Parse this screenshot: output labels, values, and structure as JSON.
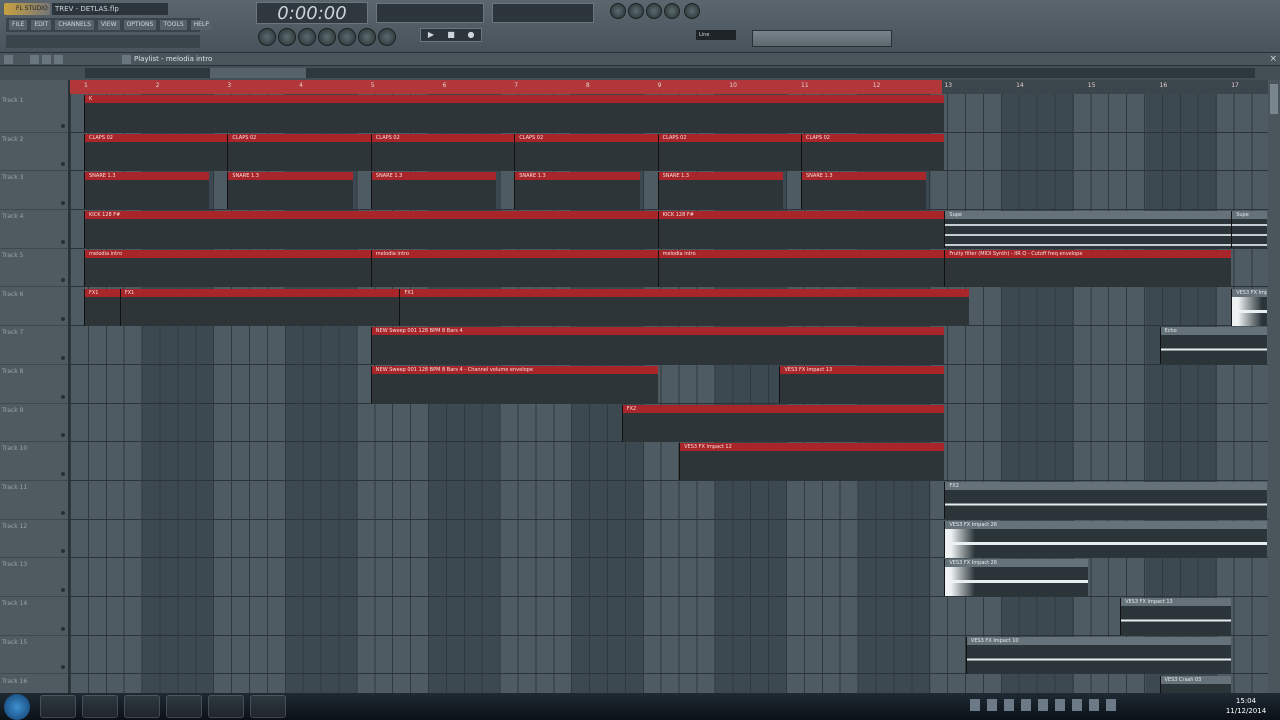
{
  "app": {
    "logo": "FL STUDIO",
    "project_title": "TREV - DETLAS.flp",
    "time_display": "0:00:00",
    "menu": [
      "FILE",
      "EDIT",
      "CHANNELS",
      "VIEW",
      "OPTIONS",
      "TOOLS",
      "HELP"
    ],
    "transport": [
      "▶",
      "■",
      "●"
    ],
    "snap_mode": "Line",
    "browser_search": ""
  },
  "playlist": {
    "title": "Playlist - melodia intro",
    "close": "×"
  },
  "ruler": [
    "1",
    "2",
    "3",
    "4",
    "5",
    "6",
    "7",
    "8",
    "9",
    "10",
    "11",
    "12",
    "13",
    "14",
    "15",
    "16",
    "17"
  ],
  "tracks": [
    "Track 1",
    "Track 2",
    "Track 3",
    "Track 4",
    "Track 5",
    "Track 6",
    "Track 7",
    "Track 8",
    "Track 9",
    "Track 10",
    "Track 11",
    "Track 12",
    "Track 13",
    "Track 14",
    "Track 15",
    "Track 16"
  ],
  "colors": {
    "clip_red": "#a8262a",
    "clip_grey": "#66727a",
    "waveform_pink": "#f2a3a6"
  },
  "clips": [
    {
      "track": 1,
      "start": 1,
      "len": 12,
      "label": "K",
      "color": "red",
      "kind": "hits"
    },
    {
      "track": 2,
      "start": 1,
      "len": 2,
      "label": "CLAPS 02",
      "color": "red",
      "kind": "hits"
    },
    {
      "track": 2,
      "start": 3,
      "len": 2,
      "label": "CLAPS 02",
      "color": "red",
      "kind": "hits"
    },
    {
      "track": 2,
      "start": 5,
      "len": 2,
      "label": "CLAPS 02",
      "color": "red",
      "kind": "hits"
    },
    {
      "track": 2,
      "start": 7,
      "len": 2,
      "label": "CLAPS 02",
      "color": "red",
      "kind": "hits"
    },
    {
      "track": 2,
      "start": 9,
      "len": 2,
      "label": "CLAPS 02",
      "color": "red",
      "kind": "hits"
    },
    {
      "track": 2,
      "start": 11,
      "len": 2,
      "label": "CLAPS 02",
      "color": "red",
      "kind": "hits"
    },
    {
      "track": 3,
      "start": 1,
      "len": 1.75,
      "label": "SNARE 1.3",
      "color": "red",
      "kind": "hits"
    },
    {
      "track": 3,
      "start": 3,
      "len": 1.75,
      "label": "SNARE 1.3",
      "color": "red",
      "kind": "hits"
    },
    {
      "track": 3,
      "start": 5,
      "len": 1.75,
      "label": "SNARE 1.3",
      "color": "red",
      "kind": "hits"
    },
    {
      "track": 3,
      "start": 7,
      "len": 1.75,
      "label": "SNARE 1.3",
      "color": "red",
      "kind": "hits"
    },
    {
      "track": 3,
      "start": 9,
      "len": 1.75,
      "label": "SNARE 1.3",
      "color": "red",
      "kind": "hits"
    },
    {
      "track": 3,
      "start": 11,
      "len": 1.75,
      "label": "SNARE 1.3",
      "color": "red",
      "kind": "hits"
    },
    {
      "track": 4,
      "start": 1,
      "len": 8,
      "label": "KICK 128 F#",
      "color": "red",
      "kind": "hits"
    },
    {
      "track": 4,
      "start": 9,
      "len": 4,
      "label": "KICK 128 F#",
      "color": "red",
      "kind": "hits"
    },
    {
      "track": 4,
      "start": 13,
      "len": 4,
      "label": "Supe",
      "color": "grey",
      "kind": "lines"
    },
    {
      "track": 4,
      "start": 17,
      "len": 0.5,
      "label": "Supe",
      "color": "grey",
      "kind": "lines"
    },
    {
      "track": 5,
      "start": 1,
      "len": 4,
      "label": "melodia intro",
      "color": "red",
      "kind": "notes"
    },
    {
      "track": 5,
      "start": 5,
      "len": 4,
      "label": "melodia intro",
      "color": "red",
      "kind": "notes"
    },
    {
      "track": 5,
      "start": 9,
      "len": 4,
      "label": "melodia intro",
      "color": "red",
      "kind": "notes"
    },
    {
      "track": 5,
      "start": 13,
      "len": 4,
      "label": "Fruity filter (MIDI Synth) - IIR Q - Cutoff freq envelope",
      "color": "red",
      "kind": "auto"
    },
    {
      "track": 6,
      "start": 1,
      "len": 0.5,
      "label": "FX1",
      "color": "red",
      "kind": "hits"
    },
    {
      "track": 6,
      "start": 1.5,
      "len": 3.9,
      "label": "FX1",
      "color": "red",
      "kind": "hits"
    },
    {
      "track": 6,
      "start": 5.4,
      "len": 7.95,
      "label": "FX1",
      "color": "red",
      "kind": "noise"
    },
    {
      "track": 6,
      "start": 17,
      "len": 0.5,
      "label": "VES3 FX Impact",
      "color": "grey",
      "kind": "greyhit"
    },
    {
      "track": 7,
      "start": 5,
      "len": 8,
      "label": "NEW Sweep 001 128 BPM 8 Bars 4",
      "color": "red",
      "kind": "noise"
    },
    {
      "track": 7,
      "start": 16,
      "len": 1.5,
      "label": "Echo",
      "color": "grey",
      "kind": "grey"
    },
    {
      "track": 8,
      "start": 5,
      "len": 4,
      "label": "NEW Sweep 001 128 BPM 8 Bars 4 - Channel volume envelope",
      "color": "red",
      "kind": "auto"
    },
    {
      "track": 8,
      "start": 10.7,
      "len": 2.3,
      "label": "VES3 FX Impact 13",
      "color": "red",
      "kind": "noise"
    },
    {
      "track": 9,
      "start": 8.5,
      "len": 4.5,
      "label": "FX2",
      "color": "red",
      "kind": "noise"
    },
    {
      "track": 10,
      "start": 9.3,
      "len": 3.7,
      "label": "VES3 FX Impact 12",
      "color": "red",
      "kind": "noise"
    },
    {
      "track": 11,
      "start": 13,
      "len": 4.5,
      "label": "FX2",
      "color": "grey",
      "kind": "grey"
    },
    {
      "track": 12,
      "start": 13,
      "len": 4.5,
      "label": "VES3 FX Impact 26",
      "color": "grey",
      "kind": "greyhit"
    },
    {
      "track": 13,
      "start": 13,
      "len": 2,
      "label": "VES3 FX Impact 26",
      "color": "grey",
      "kind": "greyhit"
    },
    {
      "track": 14,
      "start": 15.45,
      "len": 1.55,
      "label": "VES3 FX Impact 13",
      "color": "grey",
      "kind": "grey"
    },
    {
      "track": 15,
      "start": 13.3,
      "len": 3.7,
      "label": "VES3 FX Impact 10",
      "color": "grey",
      "kind": "grey"
    },
    {
      "track": 16,
      "start": 16,
      "len": 1,
      "label": "VES3 Crash 03",
      "color": "grey",
      "kind": "grey"
    }
  ],
  "taskbar": {
    "time": "15:04",
    "date": "11/12/2014"
  }
}
